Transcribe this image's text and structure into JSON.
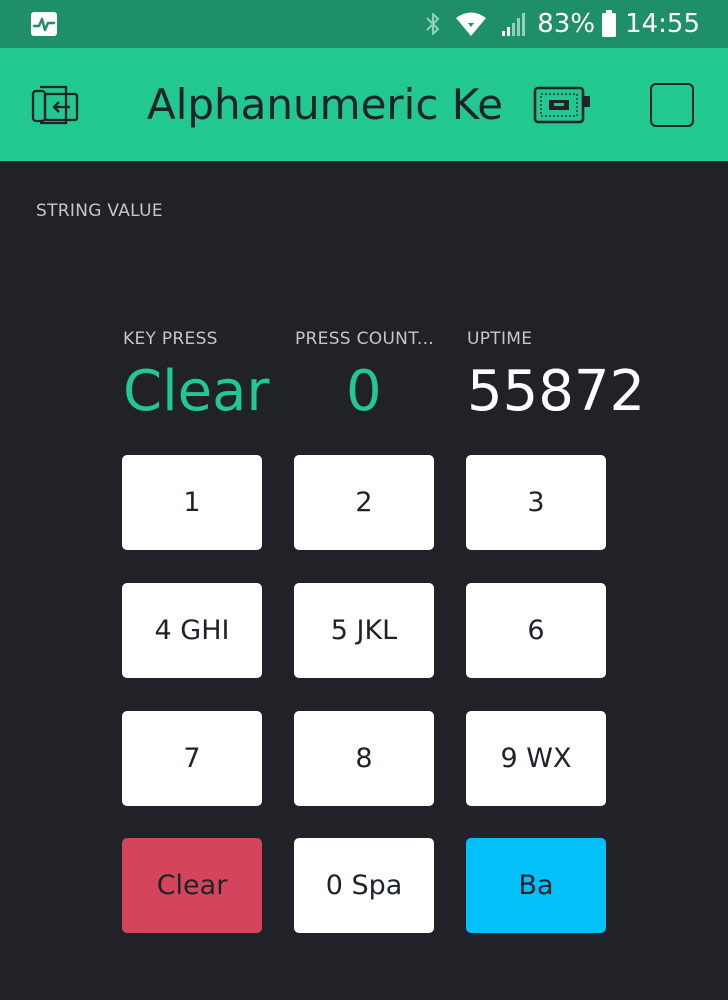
{
  "status_bar": {
    "battery_percent": "83%",
    "time": "14:55",
    "icons": [
      "activity-icon",
      "bluetooth-icon",
      "wifi-icon",
      "cellular-signal-icon",
      "battery-icon"
    ]
  },
  "header": {
    "title": "Alphanumeric Keypad",
    "icons": [
      "exit-icon",
      "device-icon",
      "stop-icon"
    ]
  },
  "widgets": {
    "string_value": {
      "label": "STRING VALUE",
      "value": ""
    },
    "key_press": {
      "label": "KEY PRESS",
      "value": "Clear"
    },
    "press_count": {
      "label": "PRESS COUNT...",
      "value": "0"
    },
    "uptime": {
      "label": "UPTIME",
      "value": "55872"
    }
  },
  "keypad": {
    "keys": [
      {
        "label": "1"
      },
      {
        "label": "2"
      },
      {
        "label": "3"
      },
      {
        "label": "4 GHI"
      },
      {
        "label": "5 JKL"
      },
      {
        "label": "6"
      },
      {
        "label": "7"
      },
      {
        "label": "8"
      },
      {
        "label": "9 WX"
      },
      {
        "label": "Clear",
        "color": "#d4455c"
      },
      {
        "label": "0 Spa"
      },
      {
        "label": "Ba",
        "color": "#04c0f8"
      }
    ]
  },
  "colors": {
    "accent": "#23c890",
    "status_bar": "#1f8f68",
    "background": "#212227"
  }
}
